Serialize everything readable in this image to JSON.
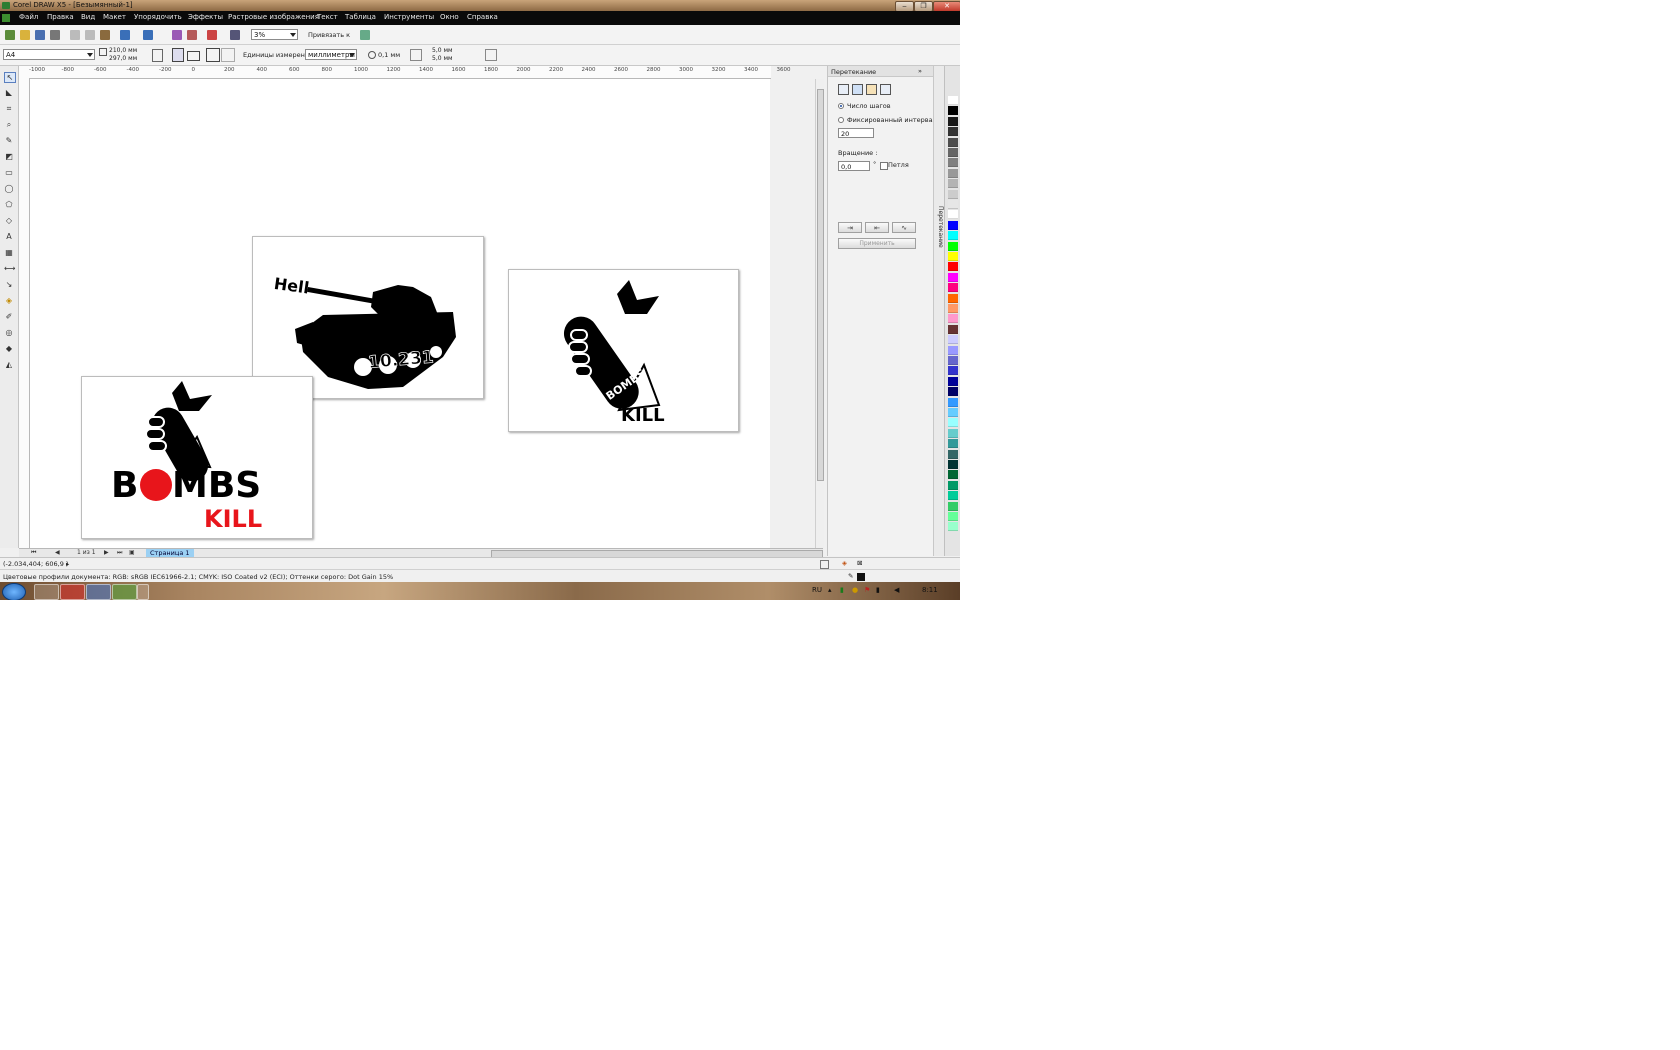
{
  "window": {
    "title": "Corel DRAW X5 - [Безымянный-1]",
    "minimize": "‒",
    "maximize": "❐",
    "close": "✕"
  },
  "menu": [
    "Файл",
    "Правка",
    "Вид",
    "Макет",
    "Упорядочить",
    "Эффекты",
    "Растровые изображения",
    "Текст",
    "Таблица",
    "Инструменты",
    "Окно",
    "Справка"
  ],
  "toolbar1": {
    "zoom": "3%",
    "snap": "Привязать к"
  },
  "toolbar2": {
    "paper": "A4",
    "width": "210,0 мм",
    "height": "297,0 мм",
    "units_label": "Единицы измерения:",
    "units_value": "миллиметры",
    "nudge": "0,1 мм",
    "dup_x": "5,0 мм",
    "dup_y": "5,0 мм"
  },
  "ruler": {
    "ticks": [
      "-1000",
      "-800",
      "-600",
      "-400",
      "-200",
      "0",
      "200",
      "400",
      "600",
      "800",
      "1000",
      "1200",
      "1400",
      "1600",
      "1800",
      "2000",
      "2200",
      "2400",
      "2600",
      "2800",
      "3000",
      "3200",
      "3400",
      "3600"
    ]
  },
  "artwork": {
    "tank_text": "Hell",
    "tank_number": "10.231",
    "bombs_left": "B",
    "bombs_right": "MBS",
    "kill": "KILL",
    "bombs_small": "BOMBS"
  },
  "pagebar": {
    "page_count": "1 из 1",
    "page_tab": "Страница 1"
  },
  "docker": {
    "title": "Перетекание",
    "radio1": "Число шагов",
    "radio2": "Фиксированный интервал",
    "steps": "20",
    "rotation_label": "Вращение :",
    "rotation_value": "0,0",
    "degree": "°",
    "loop": "Петля",
    "apply": "Применить"
  },
  "sidetabs": {
    "label": "Перетекание"
  },
  "palette": [
    "#ffffff",
    "#000000",
    "#1a1a1a",
    "#333333",
    "#4d4d4d",
    "#666666",
    "#808080",
    "#999999",
    "#b3b3b3",
    "#cccccc",
    "#e6e6e6",
    "#ffffff",
    "#0000ff",
    "#00ffff",
    "#00ff00",
    "#ffff00",
    "#ff0000",
    "#ff00ff",
    "#ff0080",
    "#ff6600",
    "#ff9966",
    "#ff99cc",
    "#663333",
    "#ccccff",
    "#9999ff",
    "#6666cc",
    "#3333cc",
    "#000099",
    "#000066",
    "#3399ff",
    "#66ccff",
    "#99ffff",
    "#66cccc",
    "#339999",
    "#336666",
    "#003333",
    "#006633",
    "#009966",
    "#00cc99",
    "#33cc66",
    "#66ff99",
    "#99ffcc"
  ],
  "status": {
    "coords": "(-2.034,404; 606,9 )",
    "profiles": "Цветовые профили документа: RGB: sRGB IEC61966-2.1; CMYK: ISO Coated v2 (ECI); Оттенки серого: Dot Gain 15%"
  },
  "tray": {
    "lang": "RU",
    "time": "8:11"
  }
}
